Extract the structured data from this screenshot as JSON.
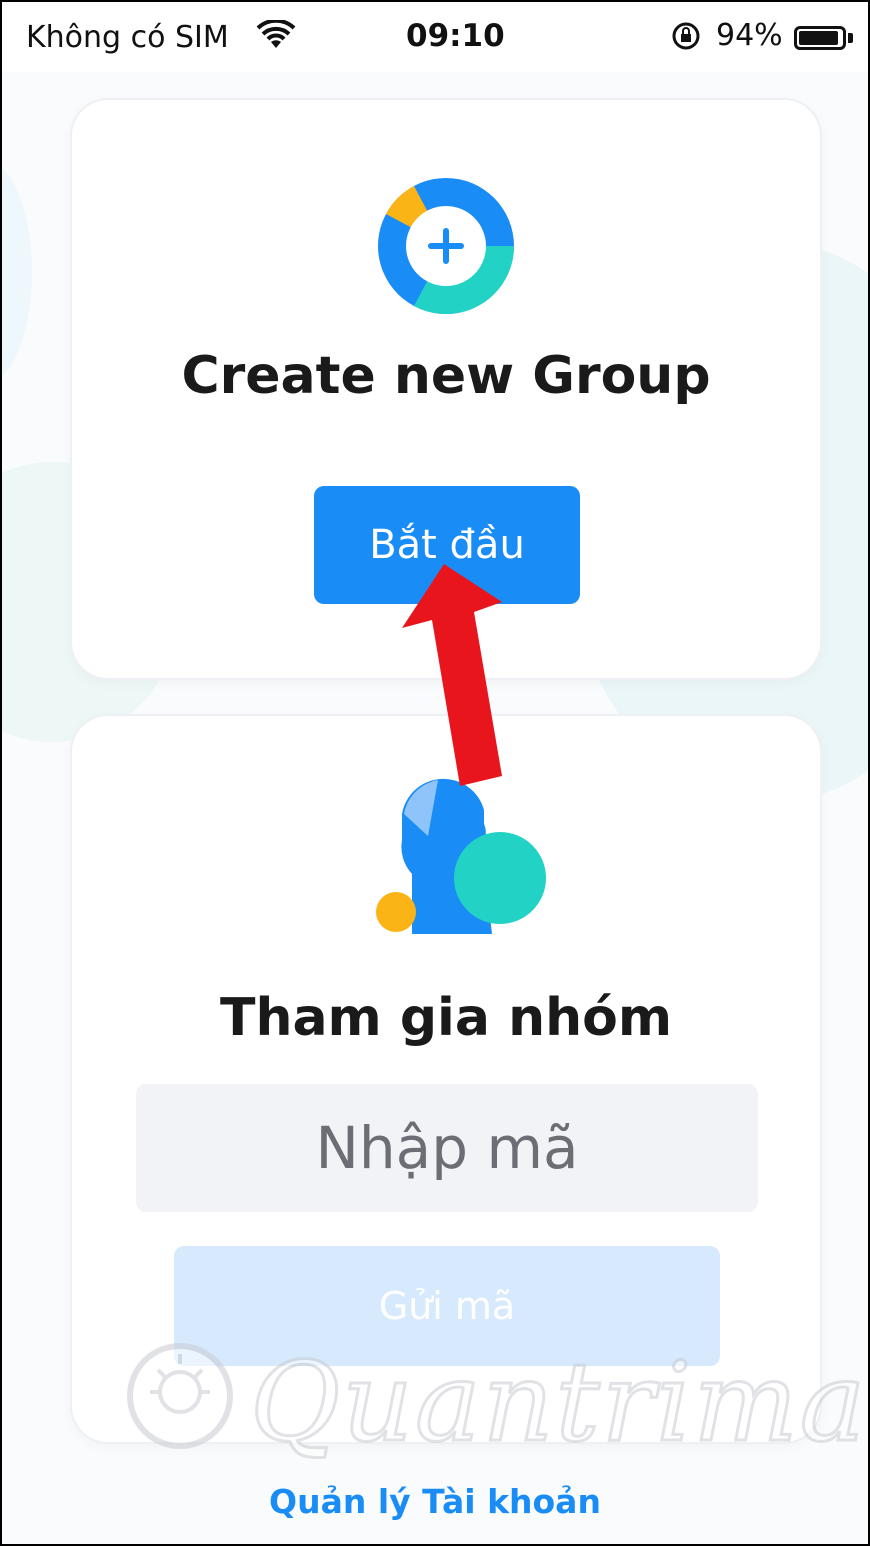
{
  "status_bar": {
    "carrier": "Không có SIM",
    "time": "09:10",
    "battery": "94%",
    "battery_level": 0.94,
    "icons": [
      "wifi-icon",
      "orientation-lock-icon",
      "battery-icon"
    ]
  },
  "create_card": {
    "icon": "add-group-icon",
    "title": "Create new Group",
    "button_label": "Bắt đầu"
  },
  "join_card": {
    "icon": "join-group-illustration",
    "title": "Tham gia nhóm",
    "code_placeholder": "Nhập mã",
    "code_value": "",
    "send_label": "Gửi mã"
  },
  "footer": {
    "manage_account_label": "Quản lý Tài khoản"
  },
  "watermark": {
    "text": "Quantrimang"
  },
  "colors": {
    "accent": "#1a8cf5",
    "teal": "#22d3c5",
    "yellow": "#fbb416",
    "annotation_arrow": "#e8161c"
  }
}
